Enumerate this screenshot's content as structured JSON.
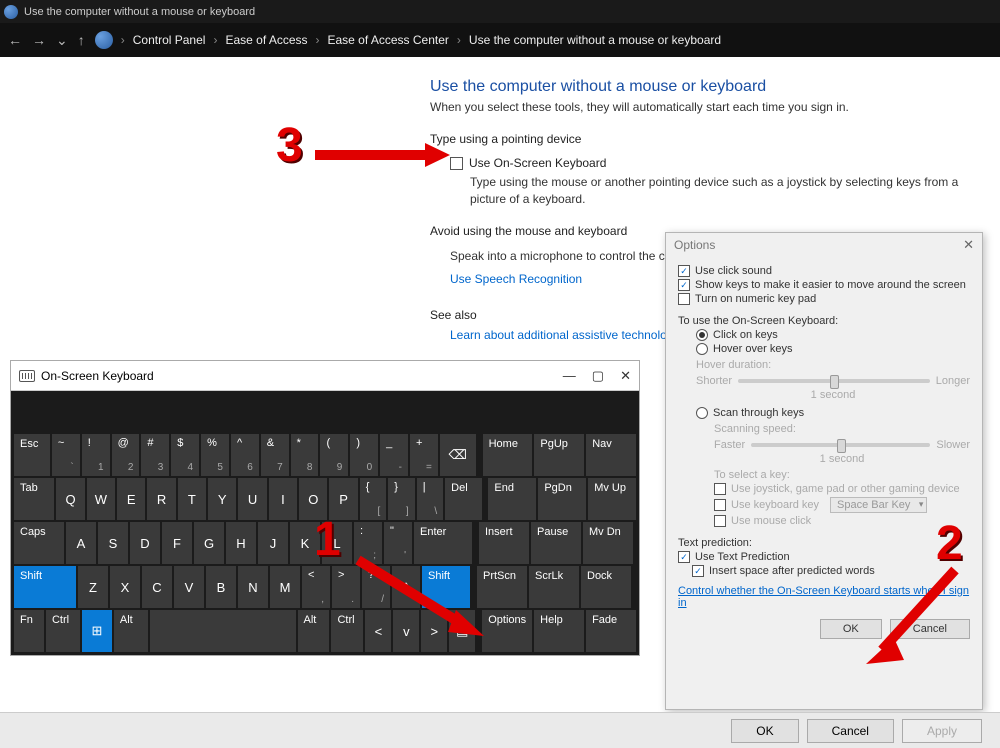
{
  "window_title": "Use the computer without a mouse or keyboard",
  "breadcrumb": [
    "Control Panel",
    "Ease of Access",
    "Ease of Access Center",
    "Use the computer without a mouse or keyboard"
  ],
  "page": {
    "heading": "Use the computer without a mouse or keyboard",
    "subheading": "When you select these tools, they will automatically start each time you sign in.",
    "section1": "Type using a pointing device",
    "osk_checkbox": "Use On-Screen Keyboard",
    "osk_desc": "Type using the mouse or another pointing device such as a joystick by selecting keys from a picture of a keyboard.",
    "section2": "Avoid using the mouse and keyboard",
    "avoid_desc": "Speak into a microphone to control the co",
    "speech_link": "Use Speech Recognition",
    "see_also": "See also",
    "see_also_link": "Learn about additional assistive technolog"
  },
  "osk": {
    "title": "On-Screen Keyboard",
    "row1": [
      {
        "t": "Esc"
      },
      {
        "t": "~",
        "s": "`"
      },
      {
        "t": "!",
        "s": "1"
      },
      {
        "t": "@",
        "s": "2"
      },
      {
        "t": "#",
        "s": "3"
      },
      {
        "t": "$",
        "s": "4"
      },
      {
        "t": "%",
        "s": "5"
      },
      {
        "t": "^",
        "s": "6"
      },
      {
        "t": "&",
        "s": "7"
      },
      {
        "t": "*",
        "s": "8"
      },
      {
        "t": "(",
        "s": "9"
      },
      {
        "t": ")",
        "s": "0"
      },
      {
        "t": "_",
        "s": "-"
      },
      {
        "t": "+",
        "s": "="
      },
      {
        "t": "⌫"
      }
    ],
    "row1_side": [
      "Home",
      "PgUp",
      "Nav"
    ],
    "row2": [
      "Tab",
      "Q",
      "W",
      "E",
      "R",
      "T",
      "Y",
      "U",
      "I",
      "O",
      "P"
    ],
    "row2_extra": [
      {
        "t": "{",
        "s": "["
      },
      {
        "t": "}",
        "s": "]"
      },
      {
        "t": "|",
        "s": "\\"
      }
    ],
    "row2_del": "Del",
    "row2_side": [
      "End",
      "PgDn",
      "Mv Up"
    ],
    "row3": [
      "Caps",
      "A",
      "S",
      "D",
      "F",
      "G",
      "H",
      "J",
      "K",
      "L"
    ],
    "row3_extra": [
      {
        "t": ":",
        "s": ";"
      },
      {
        "t": "\"",
        "s": "'"
      }
    ],
    "row3_enter": "Enter",
    "row3_side": [
      "Insert",
      "Pause",
      "Mv Dn"
    ],
    "row4_shift": "Shift",
    "row4": [
      "Z",
      "X",
      "C",
      "V",
      "B",
      "N",
      "M"
    ],
    "row4_extra": [
      {
        "t": "<",
        "s": ","
      },
      {
        "t": ">",
        "s": "."
      },
      {
        "t": "?",
        "s": "/"
      }
    ],
    "row4_side": [
      "PrtScn",
      "ScrLk",
      "Dock"
    ],
    "row5": [
      "Fn",
      "Ctrl",
      "⊞",
      "Alt"
    ],
    "row5_right": [
      "Alt",
      "Ctrl"
    ],
    "row5_opts": "Options",
    "row5_side": [
      "Help",
      "Fade"
    ]
  },
  "dlg": {
    "title": "Options",
    "c1": "Use click sound",
    "c2": "Show keys to make it easier to move around the screen",
    "c3": "Turn on numeric key pad",
    "use_label": "To use the On-Screen Keyboard:",
    "r1": "Click on keys",
    "r2": "Hover over keys",
    "hover_dur": "Hover duration:",
    "shorter": "Shorter",
    "longer": "Longer",
    "one_sec": "1 second",
    "r3": "Scan through keys",
    "scan_spd": "Scanning speed:",
    "faster": "Faster",
    "slower": "Slower",
    "sel_key": "To select a key:",
    "joy": "Use joystick, game pad or other gaming device",
    "kbkey": "Use keyboard key",
    "combo": "Space Bar Key",
    "mouse": "Use mouse click",
    "tp_label": "Text prediction:",
    "tp1": "Use Text Prediction",
    "tp2": "Insert space after predicted words",
    "link": "Control whether the On-Screen Keyboard starts when I sign in",
    "ok": "OK",
    "cancel": "Cancel"
  },
  "bottom": {
    "ok": "OK",
    "cancel": "Cancel",
    "apply": "Apply"
  },
  "annotations": {
    "n1": "1",
    "n2": "2",
    "n3": "3"
  }
}
